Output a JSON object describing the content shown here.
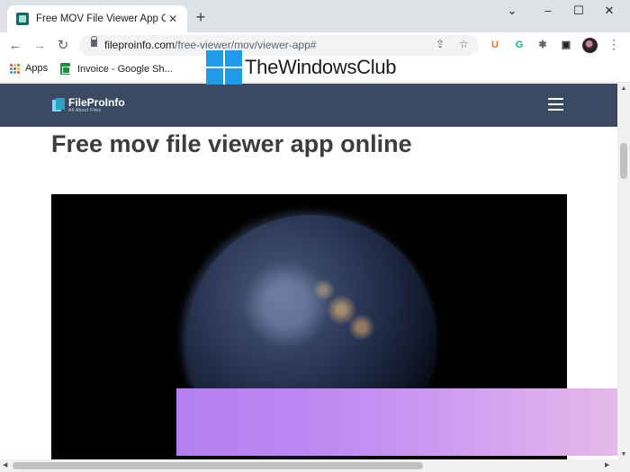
{
  "browser": {
    "tab": {
      "title": "Free MOV File Viewer App Online",
      "close": "✕"
    },
    "new_tab": "+",
    "window_controls": {
      "chevron": "⌄",
      "minimize": "–",
      "maximize": "☐",
      "close": "✕"
    },
    "url": {
      "domain": "fileproinfo.com",
      "path": "/free-viewer/mov/viewer-app#"
    },
    "nav": {
      "back": "←",
      "forward": "→",
      "reload": "↻"
    },
    "omnibox_icons": {
      "share": "⇪",
      "bookmark": "☆"
    },
    "extensions": [
      {
        "name": "ublock-icon",
        "glyph": "U",
        "color": "#e8731b"
      },
      {
        "name": "grammarly-icon",
        "glyph": "G",
        "color": "#16b28c"
      },
      {
        "name": "puzzle-icon",
        "glyph": "✱",
        "color": "#5f6368"
      },
      {
        "name": "sidepanel-icon",
        "glyph": "▣",
        "color": "#202124"
      }
    ],
    "menu": "⋮"
  },
  "bookmarks": [
    {
      "label": "Apps",
      "icon": "apps-grid-icon"
    },
    {
      "label": "Invoice - Google Sh...",
      "icon": "sheets-icon"
    }
  ],
  "apps_grid_colors": [
    "#ea4335",
    "#fbbc04",
    "#34a853",
    "#4285f4",
    "#ea4335",
    "#fbbc04",
    "#34a853",
    "#4285f4",
    "#ea4335"
  ],
  "watermark": {
    "text": "TheWindowsClub"
  },
  "site": {
    "logo_name": "FileProInfo",
    "logo_tagline": "All About Files",
    "header_color": "#3a4a63"
  },
  "page": {
    "title": "Free mov file viewer app online"
  },
  "scrollbars": {
    "up": "▲",
    "down": "▼",
    "left": "◀",
    "right": "▶"
  }
}
